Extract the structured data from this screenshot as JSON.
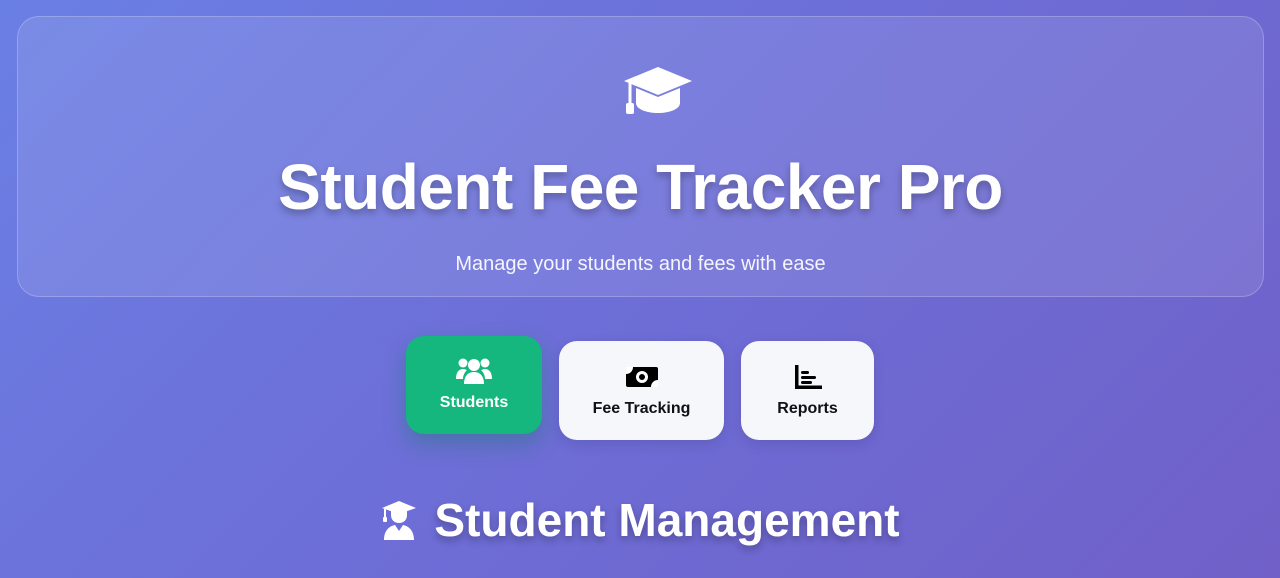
{
  "header": {
    "title": "Student Fee Tracker Pro",
    "subtitle": "Manage your students and fees with ease",
    "icon": "graduation-cap-icon"
  },
  "tabs": [
    {
      "label": "Students",
      "icon": "users-icon",
      "active": true,
      "color": "#16b67f"
    },
    {
      "label": "Fee Tracking",
      "icon": "money-bill-icon",
      "active": false
    },
    {
      "label": "Reports",
      "icon": "chart-bar-icon",
      "active": false
    }
  ],
  "section": {
    "title": "Student Management",
    "icon": "user-graduate-icon"
  },
  "colors": {
    "background_start": "#6a7fe4",
    "background_end": "#7060c8",
    "accent": "#16b67f",
    "tab_bg": "#f6f7fb"
  }
}
